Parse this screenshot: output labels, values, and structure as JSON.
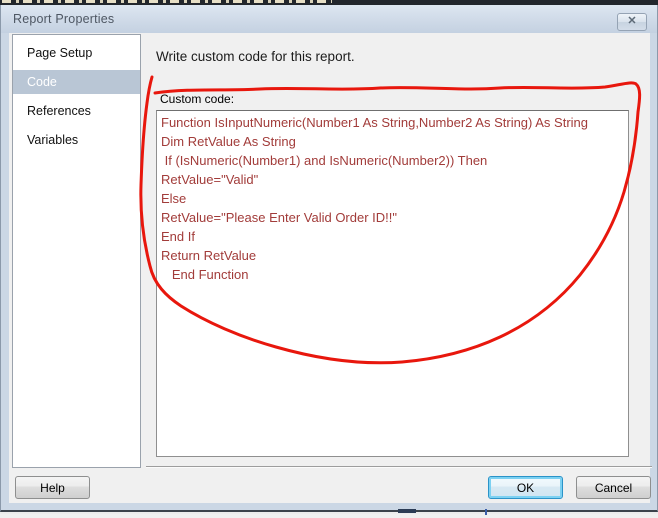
{
  "window": {
    "title": "Report Properties",
    "close_icon": "✕"
  },
  "sidebar": {
    "items": [
      {
        "label": "Page Setup",
        "selected": false
      },
      {
        "label": "Code",
        "selected": true
      },
      {
        "label": "References",
        "selected": false
      },
      {
        "label": "Variables",
        "selected": false
      }
    ]
  },
  "main": {
    "heading": "Write custom code for this report.",
    "code_label": "Custom code:",
    "code_text": "Function IsInputNumeric(Number1 As String,Number2 As String) As String\nDim RetValue As String\n If (IsNumeric(Number1) and IsNumeric(Number2)) Then\nRetValue=\"Valid\"\nElse\nRetValue=\"Please Enter Valid Order ID!!\"\nEnd If\nReturn RetValue\n   End Function"
  },
  "footer": {
    "help": "Help",
    "ok": "OK",
    "cancel": "Cancel"
  },
  "annotation": {
    "type": "hand-drawn-red-loop",
    "color": "#e8170d",
    "note": "red ink circle drawn around the Custom code area"
  },
  "colors": {
    "selection_bg": "#b9c6d5",
    "code_text": "#a23c3a",
    "dialog_bg": "#f0f0f0",
    "frame": "#cbd7e5"
  }
}
